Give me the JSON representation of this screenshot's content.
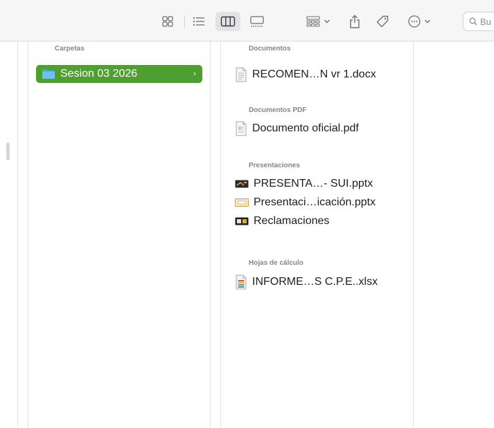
{
  "toolbar": {
    "search_placeholder": "Bu",
    "icons": [
      "icon-view-icon",
      "list-view-icon",
      "column-view-icon",
      "gallery-view-icon",
      "group-icon",
      "share-icon",
      "tag-icon",
      "more-icon",
      "search-icon"
    ],
    "active_view": "column-view"
  },
  "columns": {
    "folders": {
      "header": "Carpetas",
      "items": [
        {
          "name": "Sesion 03 2026",
          "selected": true,
          "chevron": "›"
        }
      ]
    },
    "files": {
      "header": "Documentos",
      "sections": [
        {
          "title": "Documentos",
          "items": [
            {
              "name": "RECOMEN…N vr 1.docx",
              "icon": "docx-file-icon"
            }
          ]
        },
        {
          "title": "Documentos PDF",
          "items": [
            {
              "name": "Documento oficial.pdf",
              "icon": "pdf-file-icon"
            }
          ]
        },
        {
          "title": "Presentaciones",
          "items": [
            {
              "name": "PRESENTA…- SUI.pptx",
              "icon": "pptx-file-icon"
            },
            {
              "name": "Presentaci…icación.pptx",
              "icon": "pptx-file-icon"
            },
            {
              "name": "Reclamaciones",
              "icon": "keynote-file-icon"
            }
          ]
        },
        {
          "title": "Hojas de cálculo",
          "items": [
            {
              "name": "INFORME…S C.P.E..xlsx",
              "icon": "xlsx-file-icon"
            }
          ]
        }
      ]
    }
  },
  "colors": {
    "selection": "#4e9f2f",
    "folder": "#4aa8e8",
    "toolbar_bg": "#f6f6f6",
    "section_title": "#86868b"
  }
}
